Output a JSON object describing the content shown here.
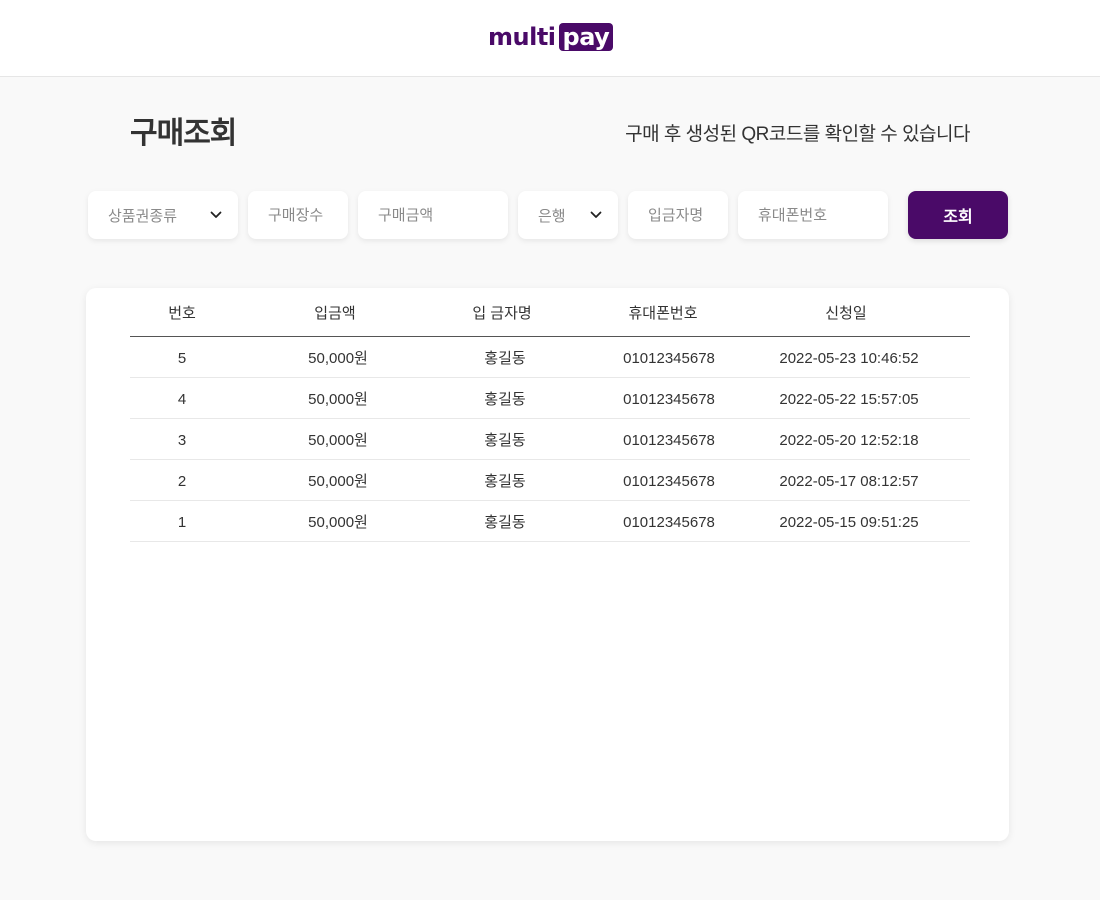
{
  "header": {
    "logo_multi": "multi",
    "logo_pay": "pay"
  },
  "page": {
    "title": "구매조회",
    "description": "구매 후 생성된 QR코드를 확인할 수 있습니다"
  },
  "filters": {
    "product_type": {
      "placeholder": "상품권종류",
      "icon": "chevron-down-icon"
    },
    "quantity": {
      "placeholder": "구매장수"
    },
    "amount": {
      "placeholder": "구매금액"
    },
    "bank": {
      "placeholder": "은행",
      "icon": "chevron-down-icon"
    },
    "depositor": {
      "placeholder": "입금자명"
    },
    "phone": {
      "placeholder": "휴대폰번호"
    },
    "search_label": "조회"
  },
  "table": {
    "headers": [
      "번호",
      "입금액",
      "입 금자명",
      "휴대폰번호",
      "신청일"
    ],
    "rows": [
      [
        "5",
        "50,000원",
        "홍길동",
        "01012345678",
        "2022-05-23 10:46:52"
      ],
      [
        "4",
        "50,000원",
        "홍길동",
        "01012345678",
        "2022-05-22 15:57:05"
      ],
      [
        "3",
        "50,000원",
        "홍길동",
        "01012345678",
        "2022-05-20 12:52:18"
      ],
      [
        "2",
        "50,000원",
        "홍길동",
        "01012345678",
        "2022-05-17 08:12:57"
      ],
      [
        "1",
        "50,000원",
        "홍길동",
        "01012345678",
        "2022-05-15 09:51:25"
      ]
    ]
  },
  "colors": {
    "brand": "#4a0a68",
    "background": "#f9f9f9"
  }
}
